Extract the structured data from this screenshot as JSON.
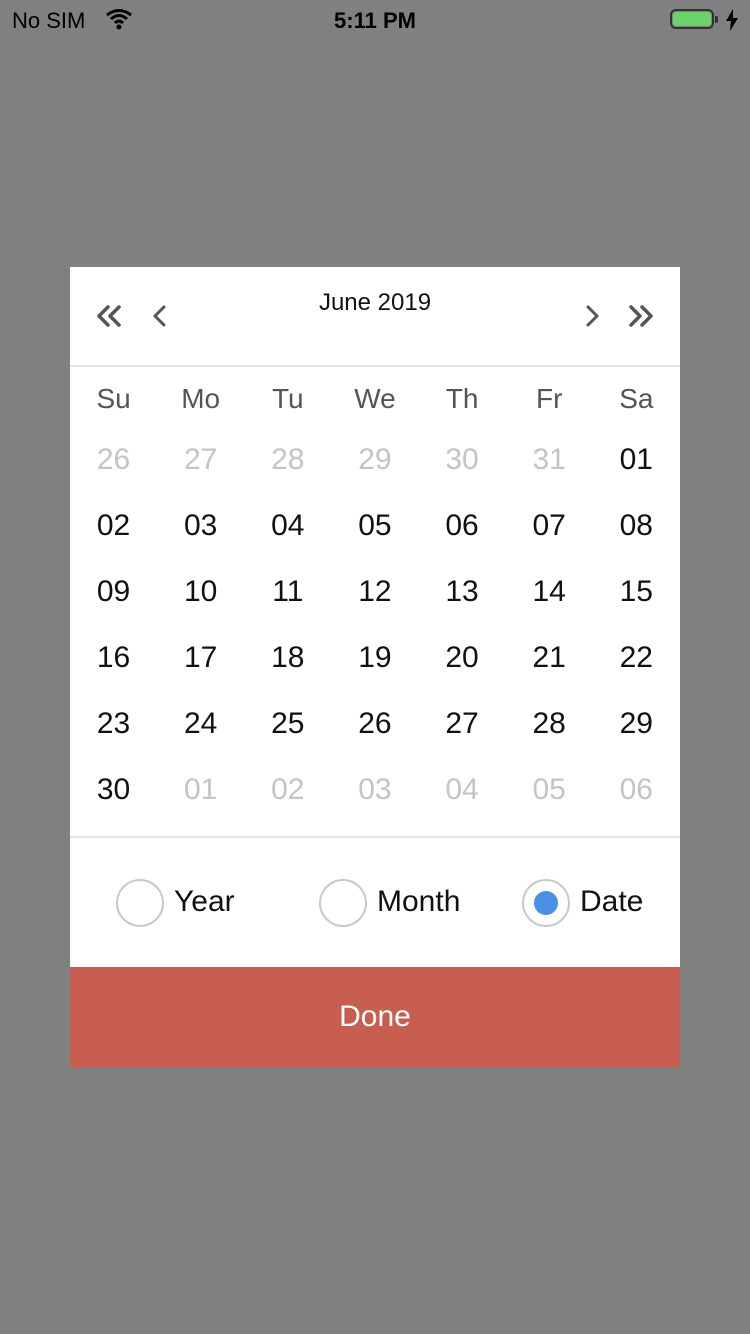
{
  "status_bar": {
    "carrier": "No SIM",
    "time": "5:11 PM",
    "battery_level_fraction": 1.0,
    "battery_color": "#6cd26a"
  },
  "calendar": {
    "month_title": "June 2019",
    "nav_icons": [
      "double-chevron-left-icon",
      "chevron-left-icon",
      "chevron-right-icon",
      "double-chevron-right-icon"
    ],
    "weekdays": [
      "Su",
      "Mo",
      "Tu",
      "We",
      "Th",
      "Fr",
      "Sa"
    ],
    "days": [
      {
        "label": "26",
        "muted": true
      },
      {
        "label": "27",
        "muted": true
      },
      {
        "label": "28",
        "muted": true
      },
      {
        "label": "29",
        "muted": true
      },
      {
        "label": "30",
        "muted": true
      },
      {
        "label": "31",
        "muted": true
      },
      {
        "label": "01",
        "muted": false
      },
      {
        "label": "02",
        "muted": false
      },
      {
        "label": "03",
        "muted": false
      },
      {
        "label": "04",
        "muted": false
      },
      {
        "label": "05",
        "muted": false
      },
      {
        "label": "06",
        "muted": false
      },
      {
        "label": "07",
        "muted": false
      },
      {
        "label": "08",
        "muted": false
      },
      {
        "label": "09",
        "muted": false
      },
      {
        "label": "10",
        "muted": false
      },
      {
        "label": "11",
        "muted": false
      },
      {
        "label": "12",
        "muted": false
      },
      {
        "label": "13",
        "muted": false
      },
      {
        "label": "14",
        "muted": false
      },
      {
        "label": "15",
        "muted": false
      },
      {
        "label": "16",
        "muted": false
      },
      {
        "label": "17",
        "muted": false
      },
      {
        "label": "18",
        "muted": false
      },
      {
        "label": "19",
        "muted": false
      },
      {
        "label": "20",
        "muted": false
      },
      {
        "label": "21",
        "muted": false
      },
      {
        "label": "22",
        "muted": false
      },
      {
        "label": "23",
        "muted": false
      },
      {
        "label": "24",
        "muted": false
      },
      {
        "label": "25",
        "muted": false
      },
      {
        "label": "26",
        "muted": false
      },
      {
        "label": "27",
        "muted": false
      },
      {
        "label": "28",
        "muted": false
      },
      {
        "label": "29",
        "muted": false
      },
      {
        "label": "30",
        "muted": false
      },
      {
        "label": "01",
        "muted": true
      },
      {
        "label": "02",
        "muted": true
      },
      {
        "label": "03",
        "muted": true
      },
      {
        "label": "04",
        "muted": true
      },
      {
        "label": "05",
        "muted": true
      },
      {
        "label": "06",
        "muted": true
      }
    ]
  },
  "modes": {
    "options": [
      {
        "label": "Year",
        "selected": false
      },
      {
        "label": "Month",
        "selected": false
      },
      {
        "label": "Date",
        "selected": true
      }
    ],
    "selected_color": "#4a90e2"
  },
  "done_button": {
    "label": "Done",
    "color": "#c85e4f"
  },
  "colors": {
    "backdrop": "#808080"
  }
}
